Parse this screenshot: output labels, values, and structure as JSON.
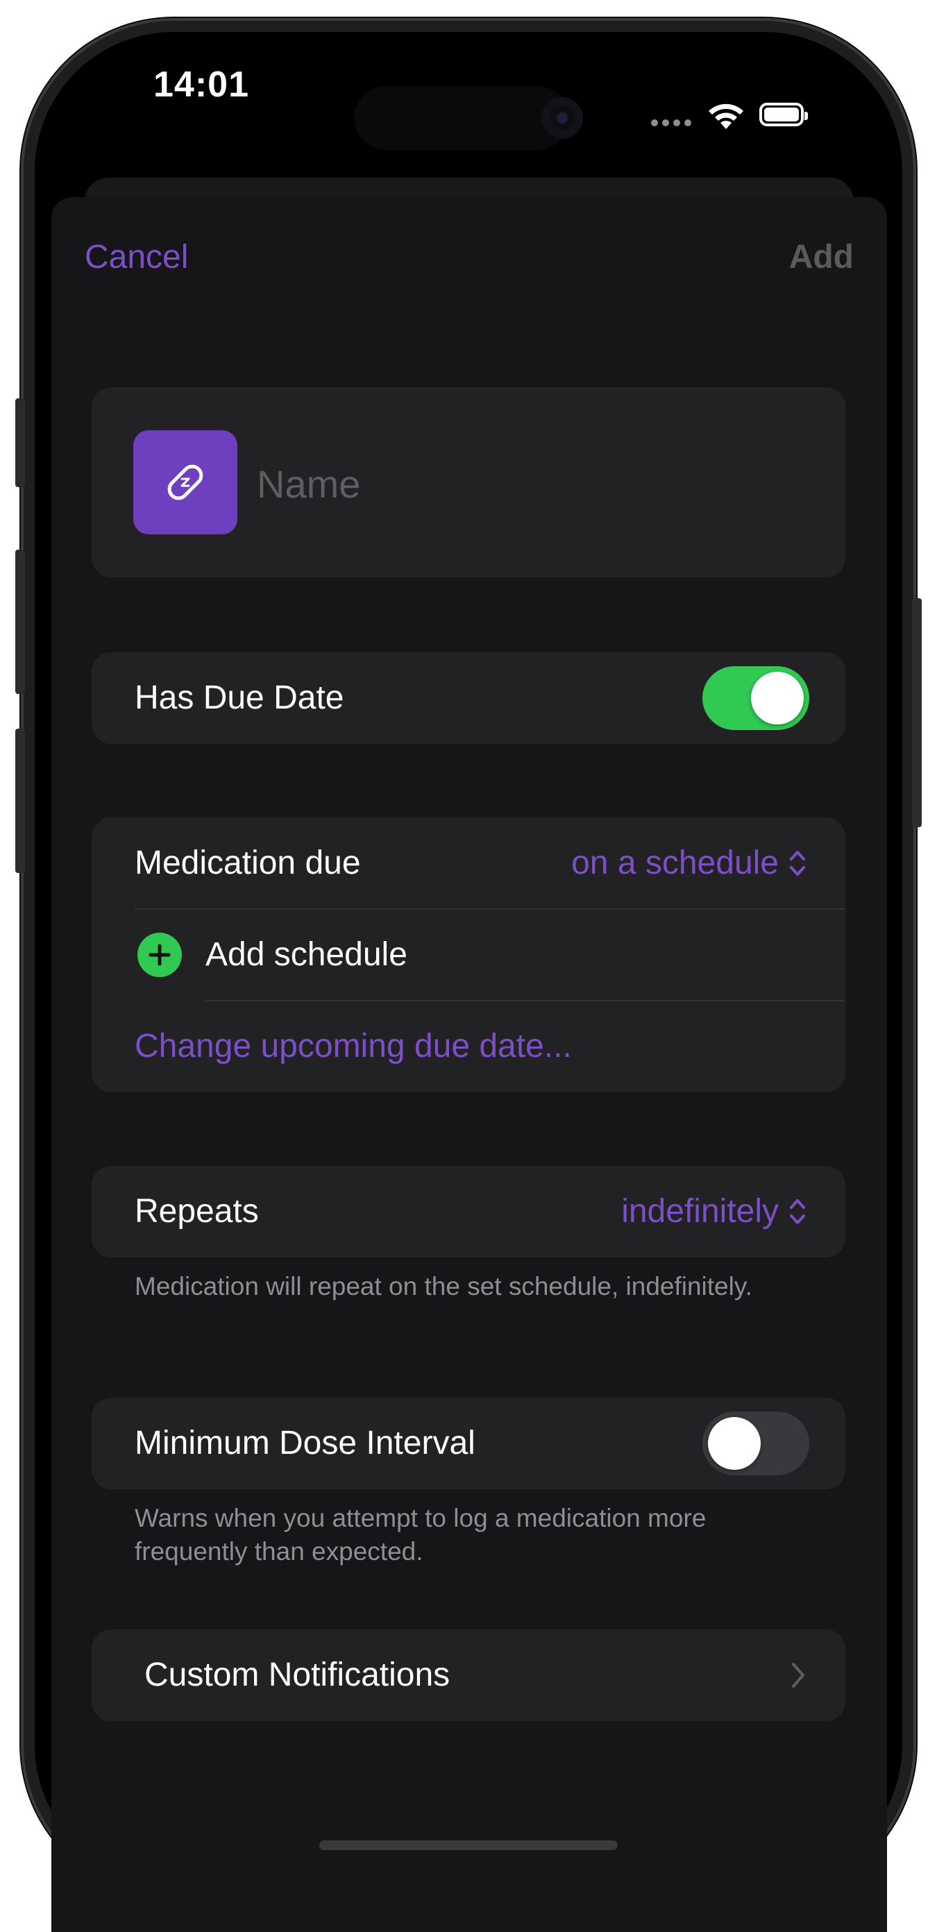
{
  "status_bar": {
    "time": "14:01",
    "wifi_icon": "wifi-icon",
    "battery_icon": "battery-icon"
  },
  "nav": {
    "cancel_label": "Cancel",
    "add_label": "Add"
  },
  "name_field": {
    "icon": "pill-icon",
    "placeholder": "Name",
    "value": ""
  },
  "due_date": {
    "label": "Has Due Date",
    "enabled": true
  },
  "schedule": {
    "label": "Medication due",
    "value": "on a schedule",
    "add_schedule_label": "Add schedule",
    "change_link_label": "Change upcoming due date..."
  },
  "repeats": {
    "label": "Repeats",
    "value": "indefinitely",
    "footnote": "Medication will repeat on the set schedule, indefinitely."
  },
  "min_dose": {
    "label": "Minimum Dose Interval",
    "enabled": false,
    "footnote": "Warns when you attempt to log a medication more frequently than expected."
  },
  "notifications": {
    "label": "Custom Notifications"
  },
  "colors": {
    "accent": "#7c4fc9",
    "toggle_on": "#30c952",
    "card": "#222224",
    "background": "#161618"
  }
}
